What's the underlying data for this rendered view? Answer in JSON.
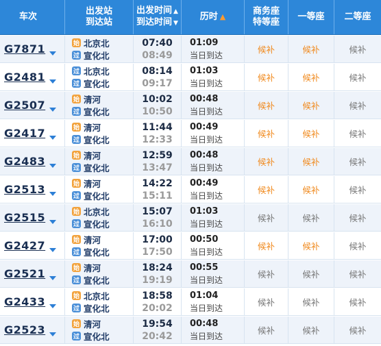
{
  "header": {
    "train": "车次",
    "station_dep": "出发站",
    "station_arr": "到达站",
    "time_dep": "出发时间",
    "time_arr": "到达时间",
    "duration": "历时",
    "business": "商务座",
    "business2": "特等座",
    "first": "一等座",
    "second": "二等座",
    "sort_up": "▲",
    "sort_down": "▼",
    "dur_sort": "▲"
  },
  "badges": {
    "start": "始",
    "pass": "过"
  },
  "colors": {
    "header_bg": "#2d87d9",
    "candidate_orange": "#f08a1e",
    "candidate_gray": "#777777"
  },
  "rows": [
    {
      "no": "G7871",
      "dep_badge": "始",
      "dep": "北京北",
      "arr_badge": "过",
      "arr": "宣化北",
      "dep_time": "07:40",
      "arr_time": "08:49",
      "dur": "01:09",
      "arrive": "当日到达",
      "biz": "候补",
      "first": "候补",
      "second": "候补",
      "biz_c": "orange",
      "first_c": "orange",
      "second_c": "gray"
    },
    {
      "no": "G2481",
      "dep_badge": "过",
      "dep": "北京北",
      "arr_badge": "过",
      "arr": "宣化北",
      "dep_time": "08:14",
      "arr_time": "09:17",
      "dur": "01:03",
      "arrive": "当日到达",
      "biz": "候补",
      "first": "候补",
      "second": "候补",
      "biz_c": "orange",
      "first_c": "orange",
      "second_c": "gray"
    },
    {
      "no": "G2507",
      "dep_badge": "始",
      "dep": "清河",
      "arr_badge": "过",
      "arr": "宣化北",
      "dep_time": "10:02",
      "arr_time": "10:50",
      "dur": "00:48",
      "arrive": "当日到达",
      "biz": "候补",
      "first": "候补",
      "second": "候补",
      "biz_c": "orange",
      "first_c": "orange",
      "second_c": "gray"
    },
    {
      "no": "G2417",
      "dep_badge": "始",
      "dep": "清河",
      "arr_badge": "过",
      "arr": "宣化北",
      "dep_time": "11:44",
      "arr_time": "12:33",
      "dur": "00:49",
      "arrive": "当日到达",
      "biz": "候补",
      "first": "候补",
      "second": "候补",
      "biz_c": "orange",
      "first_c": "orange",
      "second_c": "gray"
    },
    {
      "no": "G2483",
      "dep_badge": "始",
      "dep": "清河",
      "arr_badge": "过",
      "arr": "宣化北",
      "dep_time": "12:59",
      "arr_time": "13:47",
      "dur": "00:48",
      "arrive": "当日到达",
      "biz": "候补",
      "first": "候补",
      "second": "候补",
      "biz_c": "orange",
      "first_c": "orange",
      "second_c": "gray"
    },
    {
      "no": "G2513",
      "dep_badge": "始",
      "dep": "清河",
      "arr_badge": "过",
      "arr": "宣化北",
      "dep_time": "14:22",
      "arr_time": "15:11",
      "dur": "00:49",
      "arrive": "当日到达",
      "biz": "候补",
      "first": "候补",
      "second": "候补",
      "biz_c": "orange",
      "first_c": "orange",
      "second_c": "gray"
    },
    {
      "no": "G2515",
      "dep_badge": "始",
      "dep": "北京北",
      "arr_badge": "过",
      "arr": "宣化北",
      "dep_time": "15:07",
      "arr_time": "16:10",
      "dur": "01:03",
      "arrive": "当日到达",
      "biz": "候补",
      "first": "候补",
      "second": "候补",
      "biz_c": "gray",
      "first_c": "gray",
      "second_c": "gray"
    },
    {
      "no": "G2427",
      "dep_badge": "始",
      "dep": "清河",
      "arr_badge": "过",
      "arr": "宣化北",
      "dep_time": "17:00",
      "arr_time": "17:50",
      "dur": "00:50",
      "arrive": "当日到达",
      "biz": "候补",
      "first": "候补",
      "second": "候补",
      "biz_c": "orange",
      "first_c": "orange",
      "second_c": "gray"
    },
    {
      "no": "G2521",
      "dep_badge": "始",
      "dep": "清河",
      "arr_badge": "过",
      "arr": "宣化北",
      "dep_time": "18:24",
      "arr_time": "19:19",
      "dur": "00:55",
      "arrive": "当日到达",
      "biz": "候补",
      "first": "候补",
      "second": "候补",
      "biz_c": "gray",
      "first_c": "gray",
      "second_c": "gray"
    },
    {
      "no": "G2433",
      "dep_badge": "始",
      "dep": "北京北",
      "arr_badge": "过",
      "arr": "宣化北",
      "dep_time": "18:58",
      "arr_time": "20:02",
      "dur": "01:04",
      "arrive": "当日到达",
      "biz": "候补",
      "first": "候补",
      "second": "候补",
      "biz_c": "gray",
      "first_c": "gray",
      "second_c": "gray"
    },
    {
      "no": "G2523",
      "dep_badge": "始",
      "dep": "清河",
      "arr_badge": "过",
      "arr": "宣化北",
      "dep_time": "19:54",
      "arr_time": "20:42",
      "dur": "00:48",
      "arrive": "当日到达",
      "biz": "候补",
      "first": "候补",
      "second": "候补",
      "biz_c": "gray",
      "first_c": "gray",
      "second_c": "gray"
    }
  ]
}
